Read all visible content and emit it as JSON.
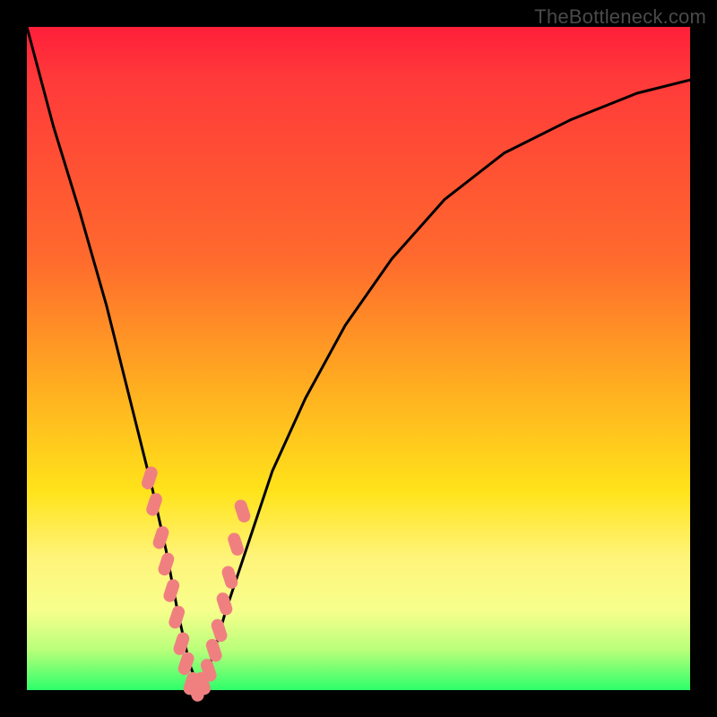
{
  "watermark": "TheBottleneck.com",
  "chart_data": {
    "type": "line",
    "title": "",
    "xlabel": "",
    "ylabel": "",
    "xlim": [
      0,
      100
    ],
    "ylim": [
      0,
      100
    ],
    "series": [
      {
        "name": "bottleneck-curve",
        "x": [
          0,
          4,
          8,
          12,
          15,
          17,
          19,
          21,
          22.7,
          24.5,
          26,
          28,
          30,
          33,
          37,
          42,
          48,
          55,
          63,
          72,
          82,
          92,
          100
        ],
        "y": [
          100,
          85,
          72,
          58,
          46,
          38,
          30,
          21,
          12,
          4,
          0,
          5,
          12,
          21,
          33,
          44,
          55,
          65,
          74,
          81,
          86,
          90,
          92
        ]
      }
    ],
    "highlight_points": {
      "name": "salmon-markers",
      "color": "#f08080",
      "x": [
        18.5,
        19.2,
        20.2,
        21.0,
        21.8,
        22.6,
        23.3,
        24.0,
        24.8,
        25.5,
        26.5,
        27.4,
        28.2,
        29.0,
        29.8,
        30.6,
        31.5,
        32.5
      ],
      "y": [
        32,
        28,
        23,
        19,
        15,
        11,
        7,
        4,
        1,
        0,
        1,
        3,
        6,
        9,
        13,
        17,
        22,
        27
      ]
    }
  }
}
